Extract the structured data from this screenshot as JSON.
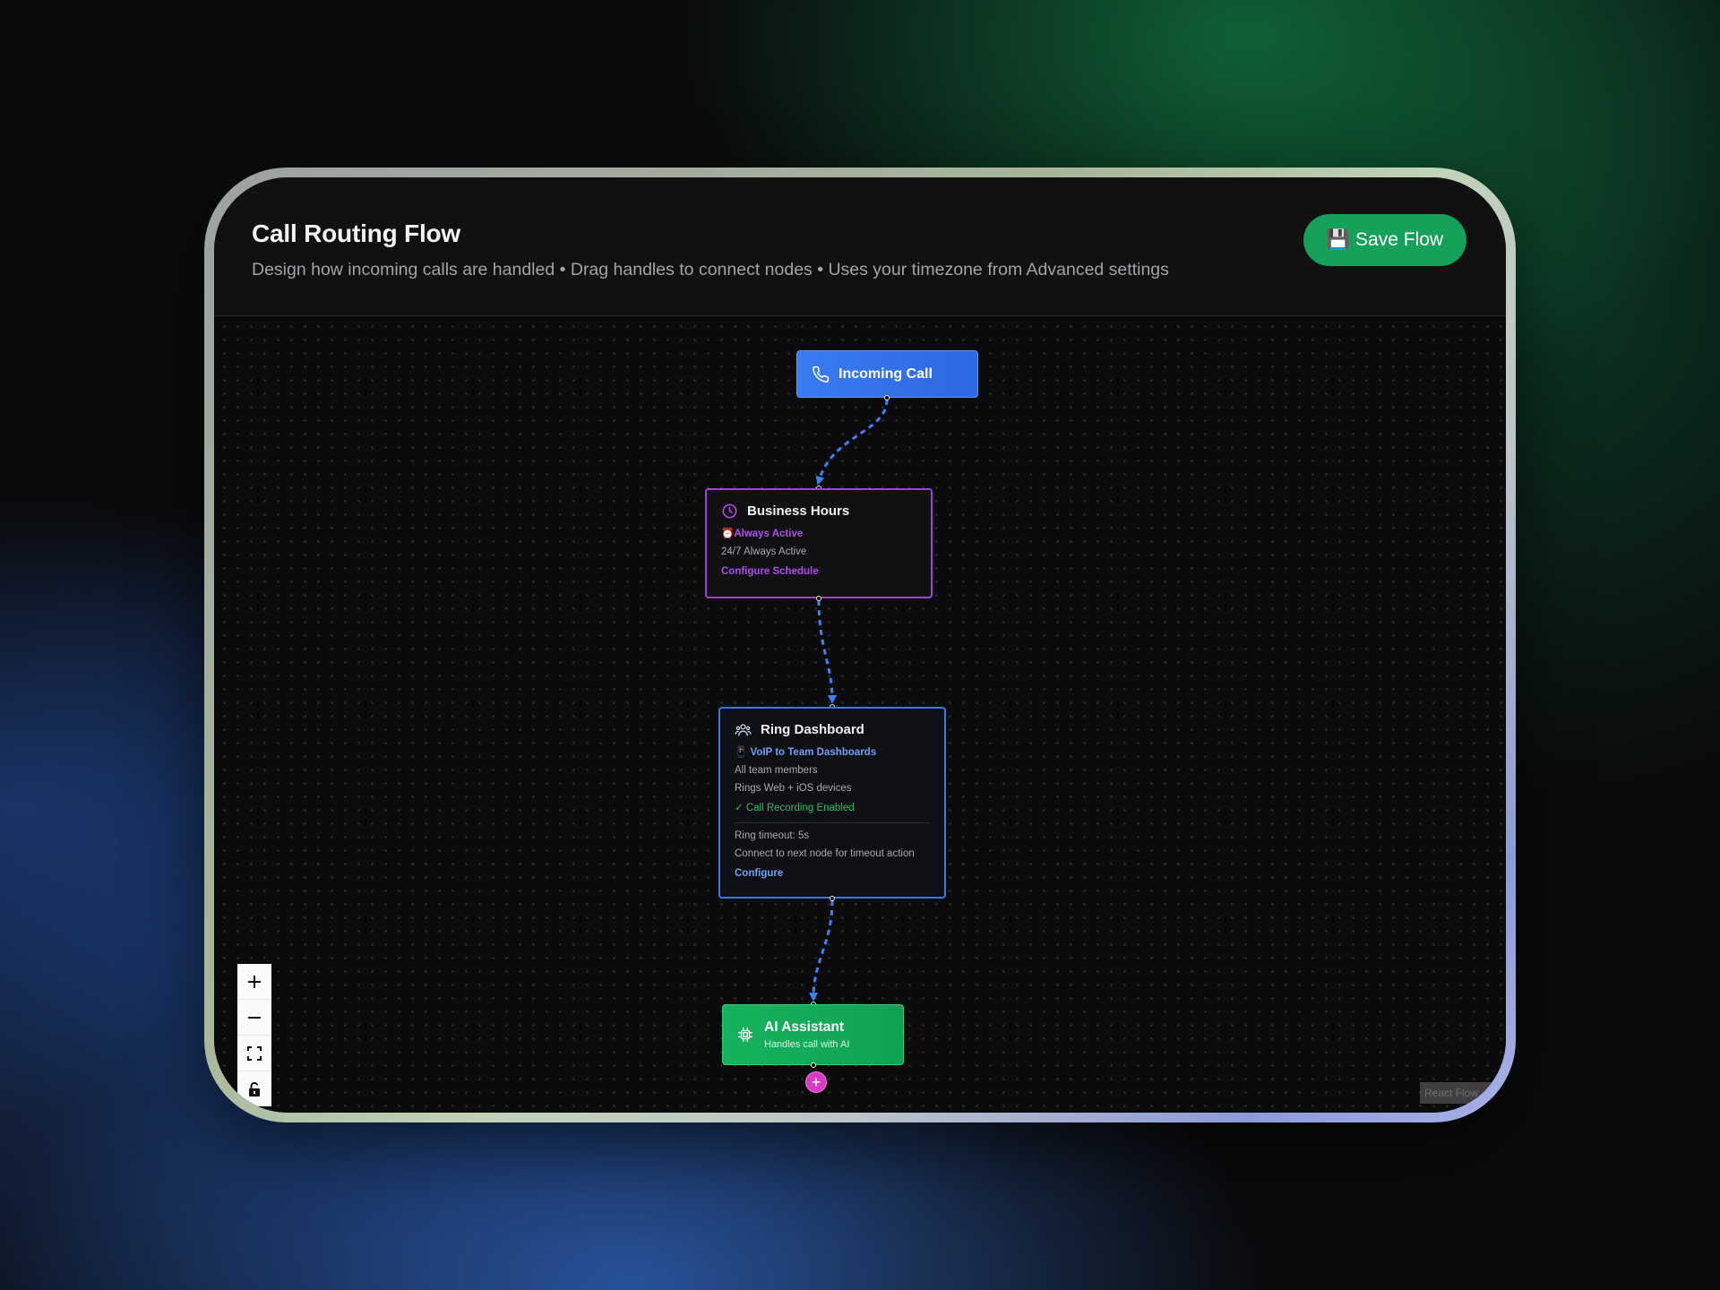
{
  "header": {
    "title": "Call Routing Flow",
    "subtitle": "Design how incoming calls are handled • Drag handles to connect nodes • Uses your timezone from Advanced settings",
    "save_icon": "💾",
    "save_label": "Save Flow"
  },
  "nodes": {
    "incoming": {
      "icon": "phone-icon",
      "label": "Incoming Call"
    },
    "business_hours": {
      "icon": "clock-icon",
      "title": "Business Hours",
      "status": "⏰Always Active",
      "detail": "24/7 Always Active",
      "action": "Configure Schedule"
    },
    "ring_dashboard": {
      "icon": "users-icon",
      "title": "Ring Dashboard",
      "mode": "📱 VoIP to Team Dashboards",
      "members": "All team members",
      "devices": "Rings Web + iOS devices",
      "recording": "✓ Call Recording Enabled",
      "timeout": "Ring timeout: 5s",
      "timeout_hint": "Connect to next node for timeout action",
      "action": "Configure"
    },
    "ai_assistant": {
      "icon": "chip-icon",
      "title": "AI Assistant",
      "subtitle": "Handles call with AI"
    }
  },
  "add_node": "+",
  "controls": [
    "zoom-in",
    "zoom-out",
    "fit-view",
    "toggle-lock"
  ],
  "attribution": "React Flow",
  "colors": {
    "accent_blue": "#2c68e3",
    "accent_purple": "#9b42e0",
    "accent_green": "#16a05a",
    "edge": "#3b82f6",
    "add_node": "#d63bc0"
  }
}
